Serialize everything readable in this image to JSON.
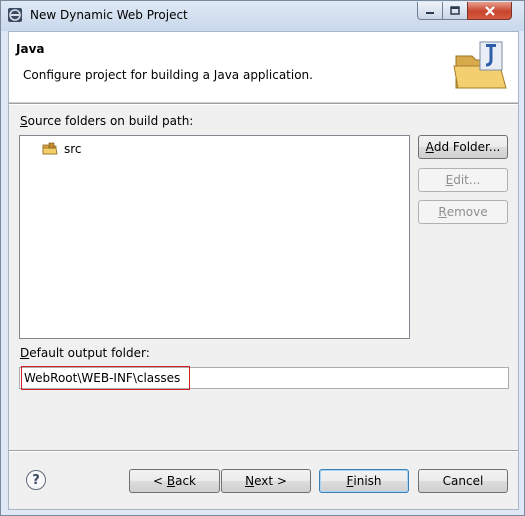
{
  "window": {
    "title": "New Dynamic Web Project"
  },
  "header": {
    "title": "Java",
    "description": "Configure project for building a Java application.",
    "graphic_icon": "java-folder-icon"
  },
  "source_folders": {
    "label_mnemonic": "S",
    "label_rest": "ource folders on build path:",
    "items": [
      {
        "label": "src",
        "icon": "package-folder-icon"
      }
    ]
  },
  "side_buttons": {
    "add_folder_mnemonic": "A",
    "add_folder_rest": "dd Folder...",
    "edit_pre": "",
    "edit_mnemonic": "E",
    "edit_rest": "dit...",
    "remove_mnemonic": "R",
    "remove_rest": "emove"
  },
  "output": {
    "label_mnemonic": "D",
    "label_rest": "efault output folder:",
    "value": "WebRoot\\WEB-INF\\classes"
  },
  "footer": {
    "help_symbol": "?",
    "back_pre": "< ",
    "back_mnemonic": "B",
    "back_rest": "ack",
    "next_mnemonic": "N",
    "next_rest": "ext >",
    "finish_mnemonic": "F",
    "finish_rest": "inish",
    "cancel_label": "Cancel"
  },
  "colors": {
    "highlight": "#d02020",
    "close_button": "#c8442d"
  }
}
